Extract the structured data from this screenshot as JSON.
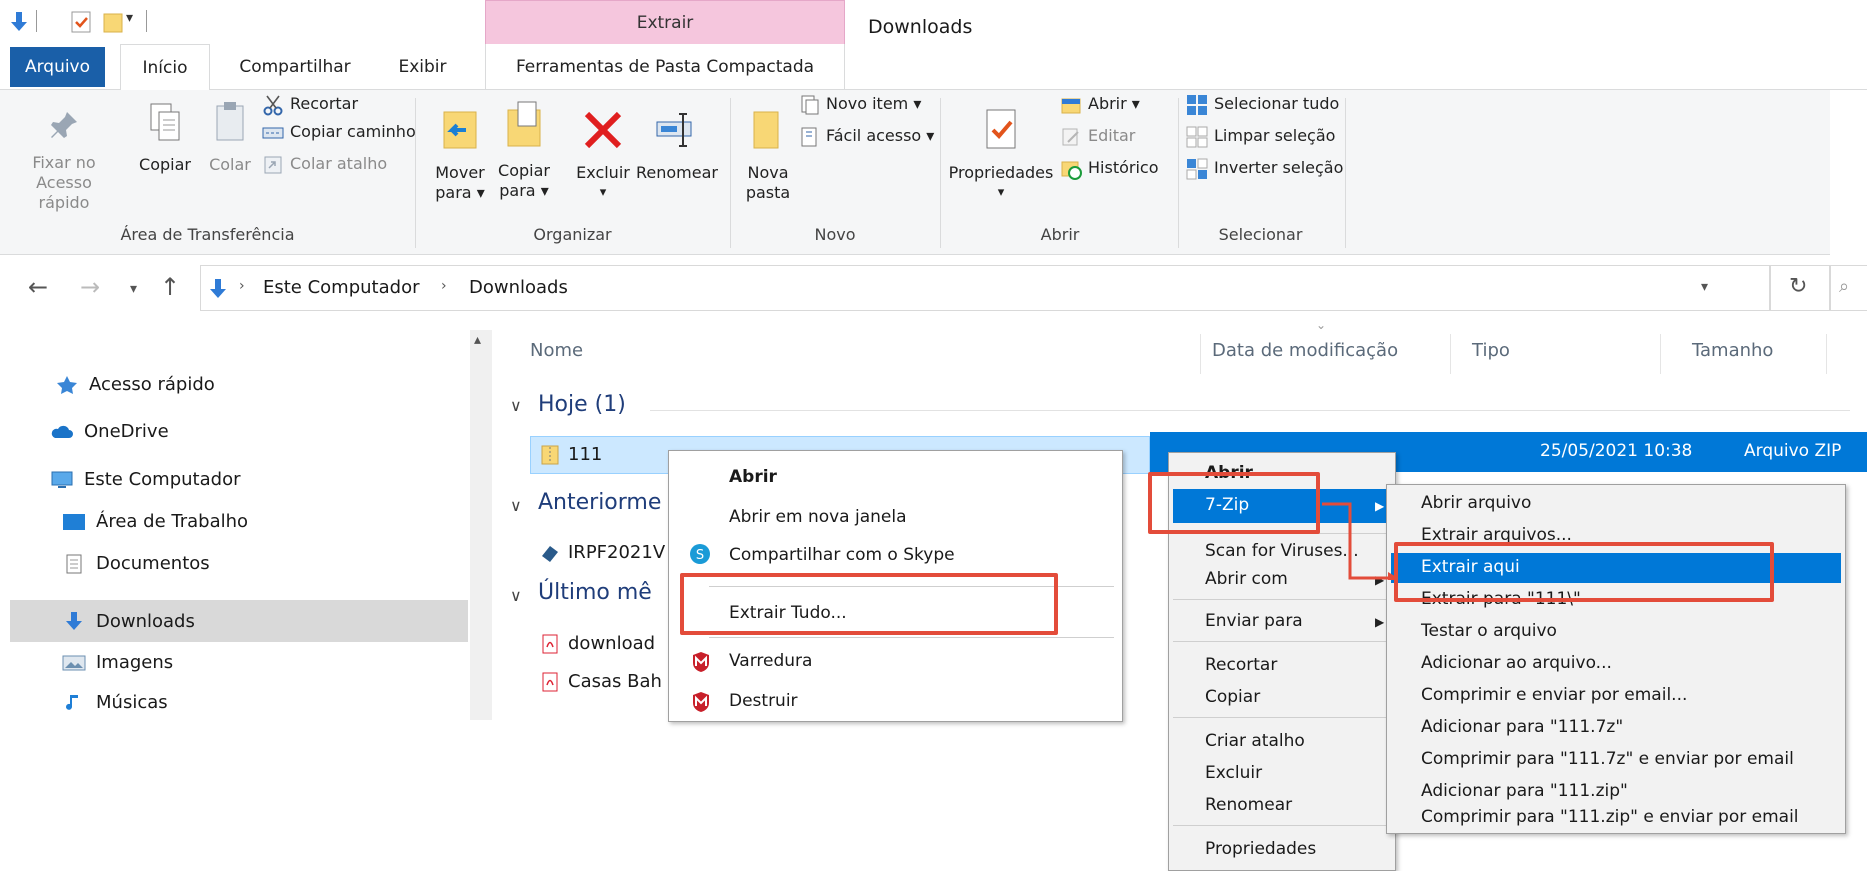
{
  "window": {
    "title": "Downloads",
    "context_tab_group": "Extrair"
  },
  "tabs": {
    "arquivo": "Arquivo",
    "inicio": "Início",
    "compartilhar": "Compartilhar",
    "exibir": "Exibir",
    "ferramentas": "Ferramentas de Pasta Compactada"
  },
  "ribbon": {
    "area_transferencia": {
      "label": "Área de Transferência",
      "fixar_line1": "Fixar no",
      "fixar_line2": "Acesso rápido",
      "copiar": "Copiar",
      "colar": "Colar",
      "recortar": "Recortar",
      "copiar_caminho": "Copiar caminho",
      "colar_atalho": "Colar atalho"
    },
    "organizar": {
      "label": "Organizar",
      "mover_line1": "Mover",
      "mover_line2": "para ▾",
      "copiar_line1": "Copiar",
      "copiar_line2": "para ▾",
      "excluir_line1": "Excluir",
      "excluir_line2": "▾",
      "renomear": "Renomear"
    },
    "novo": {
      "label": "Novo",
      "nova_line1": "Nova",
      "nova_line2": "pasta",
      "novo_item": "Novo item ▾",
      "facil_acesso": "Fácil acesso ▾"
    },
    "abrir": {
      "label": "Abrir",
      "propriedades_line1": "Propriedades",
      "propriedades_line2": "▾",
      "abrir": "Abrir ▾",
      "editar": "Editar",
      "historico": "Histórico"
    },
    "selecionar": {
      "label": "Selecionar",
      "selecionar_tudo": "Selecionar tudo",
      "limpar_selecao": "Limpar seleção",
      "inverter_selecao": "Inverter seleção"
    }
  },
  "address": {
    "crumb1": "Este Computador",
    "crumb2": "Downloads"
  },
  "nav_pane": {
    "items": [
      "Acesso rápido",
      "OneDrive",
      "Este Computador",
      "Área de Trabalho",
      "Documentos",
      "Downloads",
      "Imagens",
      "Músicas"
    ]
  },
  "file_list": {
    "columns": {
      "nome": "Nome",
      "data": "Data de modificação",
      "tipo": "Tipo",
      "tamanho": "Tamanho"
    },
    "groups": {
      "hoje": "Hoje (1)",
      "anteriormente": "Anteriorme",
      "ultimo_mes": "Último mê"
    },
    "files": {
      "f111": "111",
      "irpf": "IRPF2021V",
      "download": "download",
      "casas": "Casas Bah"
    },
    "selected_date": "25/05/2021 10:38",
    "selected_type": "Arquivo ZIP"
  },
  "context_menu_1": {
    "abrir": "Abrir",
    "abrir_nova_janela": "Abrir em nova janela",
    "compartilhar_skype": "Compartilhar com o Skype",
    "extrair_tudo": "Extrair Tudo...",
    "varredura": "Varredura",
    "destruir": "Destruir"
  },
  "context_menu_2": {
    "abrir": "Abrir",
    "seven_zip": "7-Zip",
    "scan": "Scan for Viruses...",
    "abrir_com": "Abrir com",
    "enviar_para": "Enviar para",
    "recortar": "Recortar",
    "copiar": "Copiar",
    "criar_atalho": "Criar atalho",
    "excluir": "Excluir",
    "renomear": "Renomear",
    "propriedades": "Propriedades"
  },
  "submenu_7zip": {
    "items": [
      "Abrir arquivo",
      "Extrair arquivos...",
      "Extrair aqui",
      "Extrair para \"111\\\"",
      "Testar o arquivo",
      "Adicionar ao arquivo...",
      "Comprimir e enviar por email...",
      "Adicionar para \"111.7z\"",
      "Comprimir para \"111.7z\" e enviar por email",
      "Adicionar para \"111.zip\"",
      "Comprimir para \"111.zip\" e enviar por email"
    ]
  },
  "colors": {
    "accent": "#1a5fa8",
    "highlight": "#e34c3a",
    "selection": "#0078d7",
    "context_tab": "#f5c6dd"
  }
}
